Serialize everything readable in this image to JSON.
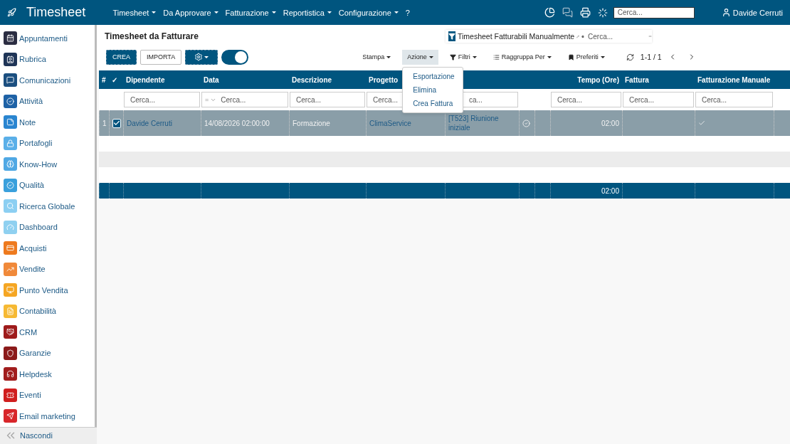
{
  "topbar": {
    "app_title": "Timesheet",
    "menus": [
      {
        "label": "Timesheet",
        "caret": true
      },
      {
        "label": "Da Approvare",
        "caret": true
      },
      {
        "label": "Fatturazione",
        "caret": true
      },
      {
        "label": "Reportistica",
        "caret": true
      },
      {
        "label": "Configurazione",
        "caret": true
      },
      {
        "label": "?",
        "caret": false
      }
    ],
    "search_placeholder": "Cerca...",
    "user": "Davide Cerruti"
  },
  "sidebar": {
    "items": [
      {
        "label": "Appuntamenti",
        "color": "#2b2d42"
      },
      {
        "label": "Rubrica",
        "color": "#1f3557"
      },
      {
        "label": "Comunicazioni",
        "color": "#1b4f80"
      },
      {
        "label": "Attività",
        "color": "#1e62a6"
      },
      {
        "label": "Note",
        "color": "#2a85d0"
      },
      {
        "label": "Portafogli",
        "color": "#5aafe8"
      },
      {
        "label": "Know-How",
        "color": "#4fa8e4"
      },
      {
        "label": "Qualità",
        "color": "#3aa0dc"
      },
      {
        "label": "Ricerca Globale",
        "color": "#8ccff2"
      },
      {
        "label": "Dashboard",
        "color": "#8fd0f0"
      },
      {
        "label": "Acquisti",
        "color": "#ee7a1e"
      },
      {
        "label": "Vendite",
        "color": "#f0893a"
      },
      {
        "label": "Punto Vendita",
        "color": "#f5a623"
      },
      {
        "label": "Contabilità",
        "color": "#f6b933"
      },
      {
        "label": "CRM",
        "color": "#9e1b1b"
      },
      {
        "label": "Garanzie",
        "color": "#8b1a1a"
      },
      {
        "label": "Helpdesk",
        "color": "#a11d1d"
      },
      {
        "label": "Eventi",
        "color": "#d01f1f"
      },
      {
        "label": "Email marketing",
        "color": "#d8262a"
      }
    ],
    "hide_label": "Nascondi"
  },
  "page_title": "Timesheet da Fatturare",
  "filter_tag": "Timesheet Fatturabili Manualmente",
  "search_placeholder": "Cerca...",
  "buttons": {
    "create": "CREA",
    "import": "IMPORTA"
  },
  "toggle": {
    "on": true
  },
  "toolbar": [
    {
      "label": "Stampa",
      "kind": "plain",
      "open": false
    },
    {
      "label": "Azione",
      "kind": "plain",
      "open": true
    },
    {
      "label": "Filtri",
      "kind": "filter",
      "open": false
    },
    {
      "label": "Raggruppa Per",
      "kind": "group",
      "open": false
    },
    {
      "label": "Preferiti",
      "kind": "bookmark",
      "open": false
    }
  ],
  "pager": "1-1 / 1",
  "action_menu": [
    "Esportazione",
    "Elimina",
    "Crea Fattura"
  ],
  "table": {
    "columns": [
      {
        "label": "#"
      },
      {
        "label": "✓"
      },
      {
        "label": "Dipendente"
      },
      {
        "label": "Data"
      },
      {
        "label": "Descrizione"
      },
      {
        "label": "Progetto"
      },
      {},
      {},
      {},
      {
        "label": "Tempo (Ore)"
      },
      {
        "label": "Fattura"
      },
      {
        "label": "Fatturazione Manuale"
      },
      {}
    ],
    "filters": [
      {
        "kind": "none"
      },
      {
        "kind": "none"
      },
      {
        "kind": "text",
        "placeholder": "Cerca..."
      },
      {
        "kind": "date",
        "operator": "=",
        "placeholder": "Cerca..."
      },
      {
        "kind": "text",
        "placeholder": "Cerca..."
      },
      {
        "kind": "text",
        "placeholder": "Cerca..."
      },
      {
        "kind": "text",
        "placeholder": "ca..."
      },
      {
        "kind": "none"
      },
      {
        "kind": "none"
      },
      {
        "kind": "text",
        "placeholder": "Cerca..."
      },
      {
        "kind": "text",
        "placeholder": "Cerca..."
      },
      {
        "kind": "text",
        "placeholder": "Cerca..."
      },
      {
        "kind": "none"
      }
    ],
    "rows": [
      {
        "number": "1",
        "selected": true,
        "dipendente": "Davide Cerruti",
        "data": "14/08/2026 02:00:00",
        "descrizione": "Formazione",
        "progetto": "ClimaService",
        "attivita": "[T523] Riunione iniziale",
        "done": true,
        "tempo": "02:00",
        "manuale": true
      }
    ],
    "footer_total": "02:00"
  }
}
